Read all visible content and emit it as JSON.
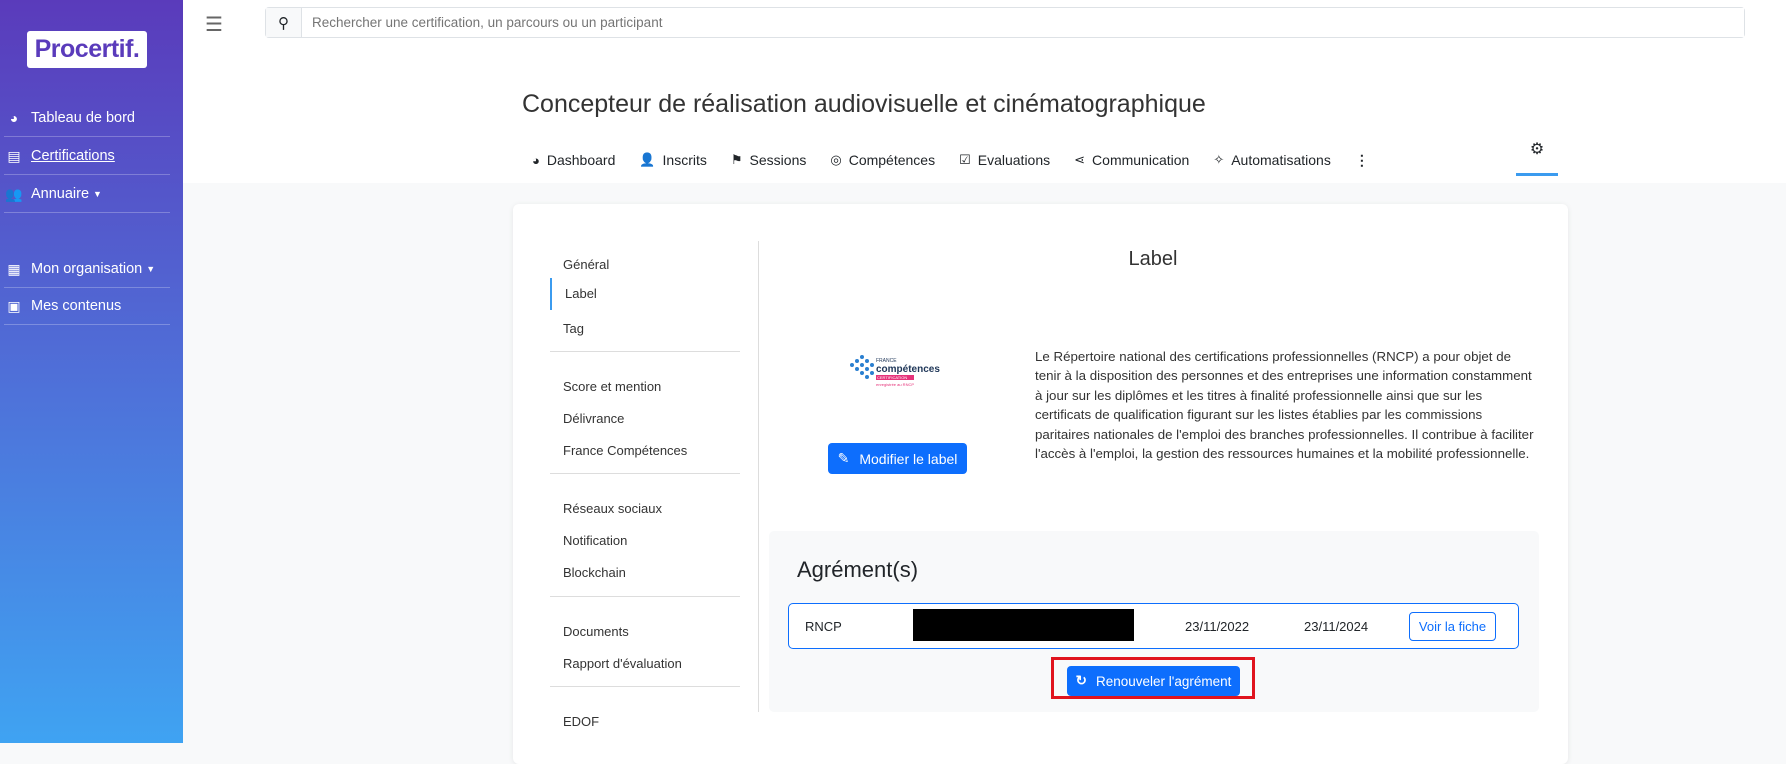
{
  "sidebar": {
    "logo": "Procertif.",
    "items": [
      {
        "label": "Tableau de bord",
        "icon": "gauge-icon"
      },
      {
        "label": "Certifications",
        "icon": "id-card-icon"
      },
      {
        "label": "Annuaire",
        "icon": "users-icon"
      },
      {
        "label": "Mon organisation",
        "icon": "building-icon"
      },
      {
        "label": "Mes contenus",
        "icon": "images-icon"
      }
    ]
  },
  "search": {
    "placeholder": "Rechercher une certification, un parcours ou un participant"
  },
  "header": {
    "title": "Concepteur de réalisation audiovisuelle et cinématographique",
    "tabs": [
      {
        "label": "Dashboard"
      },
      {
        "label": "Inscrits"
      },
      {
        "label": "Sessions"
      },
      {
        "label": "Compétences"
      },
      {
        "label": "Evaluations"
      },
      {
        "label": "Communication"
      },
      {
        "label": "Automatisations"
      }
    ]
  },
  "menu": [
    "Général",
    "Label",
    "Tag",
    "Score et mention",
    "Délivrance",
    "France Compétences",
    "Réseaux sociaux",
    "Notification",
    "Blockchain",
    "Documents",
    "Rapport d'évaluation",
    "EDOF"
  ],
  "label": {
    "heading": "Label",
    "logo_text": [
      "FRANCE",
      "compétences",
      "CERTIFICATION",
      "enregistrée au RNCP"
    ],
    "edit_button": "Modifier le label",
    "description": "Le Répertoire national des certifications professionnelles (RNCP) a pour objet de tenir à la disposition des personnes et des entreprises une information constamment à jour sur les diplômes et les titres à finalité professionnelle ainsi que sur les certificats de qualification figurant sur les listes établies par les commissions paritaires nationales de l'emploi des branches professionnelles. Il contribue à faciliter l'accès à l'emploi, la gestion des ressources humaines et la mobilité professionnelle."
  },
  "agrements": {
    "heading": "Agrément(s)",
    "rows": [
      {
        "type": "RNCP",
        "start": "23/11/2022",
        "end": "23/11/2024",
        "action": "Voir la fiche"
      }
    ],
    "renew_button": "Renouveler l'agrément"
  },
  "colors": {
    "primary": "#0d6efd",
    "highlight": "#e0141e"
  }
}
